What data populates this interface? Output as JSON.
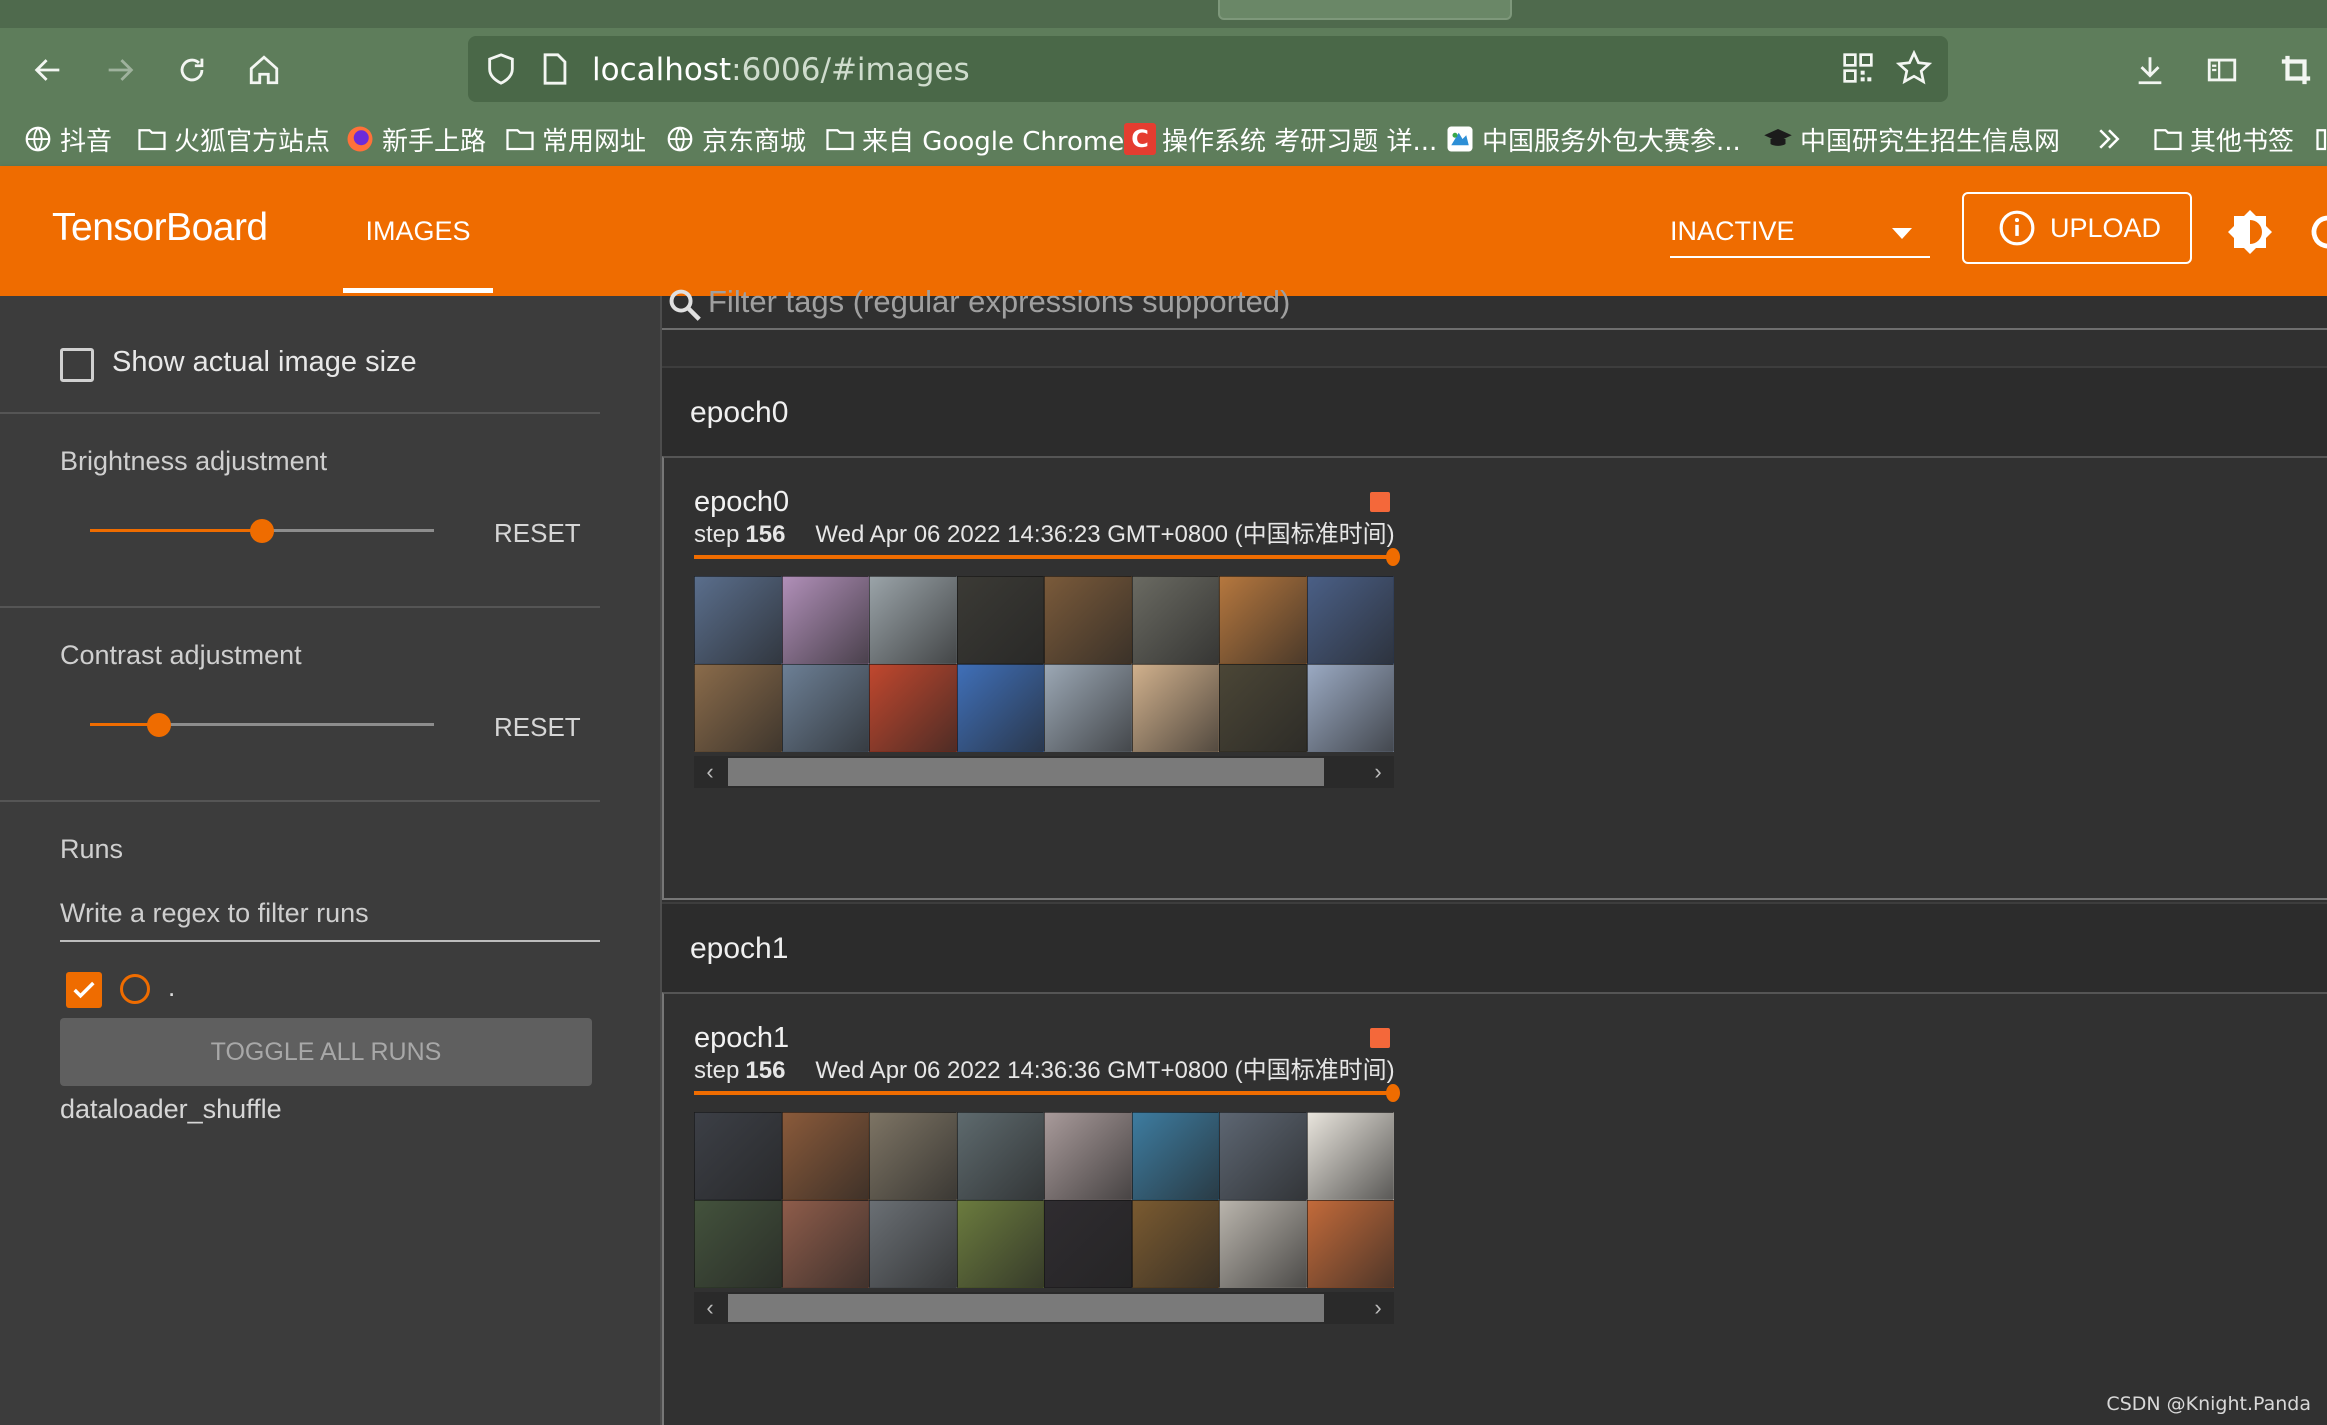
{
  "browser": {
    "url_host": "localhost",
    "url_path": ":6006/#images",
    "bookmarks": [
      {
        "label": "抖音",
        "icon": "globe-icon"
      },
      {
        "label": "火狐官方站点",
        "icon": "folder-icon"
      },
      {
        "label": "新手上路",
        "icon": "firefox-icon"
      },
      {
        "label": "常用网址",
        "icon": "folder-icon"
      },
      {
        "label": "京东商城",
        "icon": "globe-icon"
      },
      {
        "label": "来自 Google Chrome",
        "icon": "folder-icon"
      },
      {
        "label": "操作系统 考研习题 详...",
        "icon": "csdn-icon"
      },
      {
        "label": "中国服务外包大赛参...",
        "icon": "site-icon"
      },
      {
        "label": "中国研究生招生信息网",
        "icon": "grad-cap-icon"
      },
      {
        "label": "其他书签",
        "icon": "folder-icon"
      }
    ]
  },
  "toolbar": {
    "brand": "TensorBoard",
    "tab_images": "IMAGES",
    "run_status": "INACTIVE",
    "upload_label": "UPLOAD"
  },
  "sidebar": {
    "show_actual_size": "Show actual image size",
    "brightness_label": "Brightness adjustment",
    "brightness_value": 0.5,
    "contrast_label": "Contrast adjustment",
    "contrast_value": 0.2,
    "reset_label": "RESET",
    "runs_label": "Runs",
    "runs_filter_placeholder": "Write a regex to filter runs",
    "run_name": ".",
    "toggle_all": "TOGGLE ALL RUNS",
    "tag_name": "dataloader_shuffle"
  },
  "main": {
    "filter_placeholder": "Filter tags (regular expressions supported)",
    "groups": [
      {
        "name": "epoch0",
        "card_title": "epoch0",
        "step_label": "step",
        "step": "156",
        "date": "Wed Apr 06 2022 14:36:23 GMT+0800 (中国标准时间)",
        "thumb_colors": [
          "#5a6e8c",
          "#b08fb8",
          "#9aa3a8",
          "#3b3a35",
          "#7a5a3a",
          "#6a6a62",
          "#b5773e",
          "#4a5f86",
          "#8a6b4a",
          "#6c7f95",
          "#c0472e",
          "#3f6fb8",
          "#9ba7b4",
          "#d0b08c",
          "#4b4636",
          "#9aa9c2"
        ]
      },
      {
        "name": "epoch1",
        "card_title": "epoch1",
        "step_label": "step",
        "step": "156",
        "date": "Wed Apr 06 2022 14:36:36 GMT+0800 (中国标准时间)",
        "thumb_colors": [
          "#3c3f46",
          "#8a5a3a",
          "#7d7464",
          "#5e6a6e",
          "#a89a9a",
          "#3d7ca0",
          "#5d6672",
          "#e8e4dc",
          "#43523c",
          "#8e5c4a",
          "#6a6f74",
          "#6b7b3e",
          "#2f2c30",
          "#7a5a30",
          "#b9b4ac",
          "#c26a3a"
        ]
      }
    ]
  },
  "watermark": "CSDN @Knight.Panda"
}
